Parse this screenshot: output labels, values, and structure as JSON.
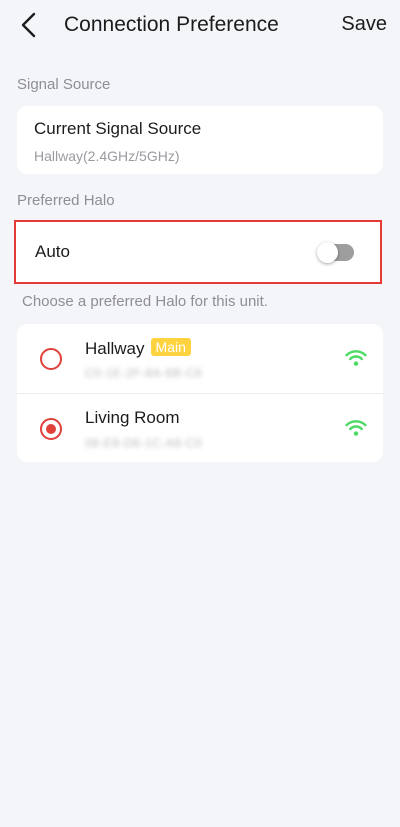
{
  "header": {
    "title": "Connection Preference",
    "save_label": "Save",
    "back_icon": "chevron-left-icon"
  },
  "signal_source": {
    "section_label": "Signal Source",
    "title": "Current Signal Source",
    "value": "Hallway(2.4GHz/5GHz)"
  },
  "preferred_halo": {
    "section_label": "Preferred Halo",
    "auto_label": "Auto",
    "auto_enabled": false,
    "hint": "Choose a preferred Halo for this unit.",
    "items": [
      {
        "name": "Hallway",
        "badge": "Main",
        "mac": "C0-1E-2F-8A-6B-C6",
        "selected": false,
        "signal_icon": "wifi-icon"
      },
      {
        "name": "Living Room",
        "badge": "",
        "mac": "08-E8-D6-1C-A8-C0",
        "selected": true,
        "signal_icon": "wifi-icon"
      }
    ]
  },
  "colors": {
    "accent": "#e0413a",
    "badge": "#ffd23f",
    "wifi": "#4cd964",
    "highlight_border": "#e53935"
  }
}
